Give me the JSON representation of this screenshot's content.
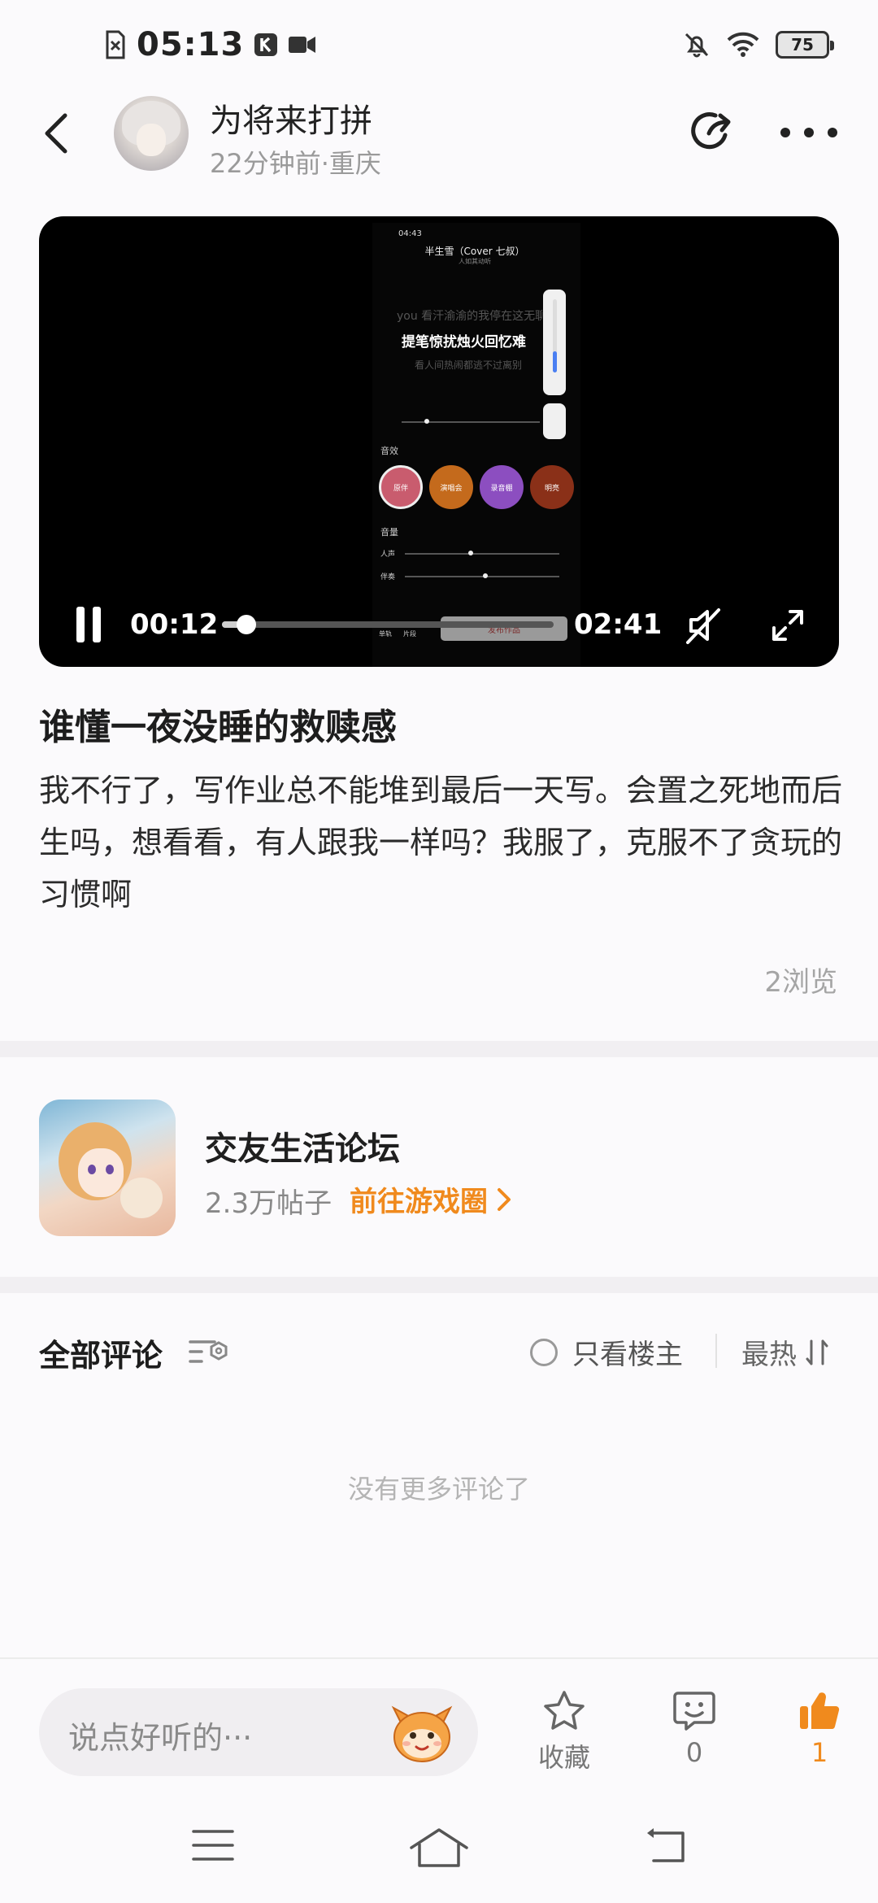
{
  "status_bar": {
    "time": "05:13",
    "battery": "75",
    "icons": [
      "sim-off-icon",
      "k-app-icon",
      "video-record-icon",
      "bell-off-icon",
      "wifi-icon",
      "battery-icon"
    ]
  },
  "header": {
    "user_name": "为将来打拼",
    "meta": "22分钟前·重庆",
    "icons": [
      "back-icon",
      "share-icon",
      "more-icon"
    ]
  },
  "video": {
    "current_time": "00:12",
    "duration": "02:41",
    "progress": 0.074,
    "embedded_screen": {
      "time": "04:43",
      "song_title": "半生雪（Cover 七叔）",
      "artist": "人如其动听",
      "lyric_prev": "you 看汗渝渝的我停在这无聊",
      "lyric_current": "提笔惊扰烛火回忆难",
      "lyric_next": "看人间热闹都逃不过离别",
      "section_effects": "音效",
      "effect_1": "原伴",
      "effect_2": "演唱会",
      "effect_3": "录音棚",
      "effect_4": "明亮",
      "section_volume": "音量",
      "vocal_label": "人声",
      "accomp_label": "伴奏",
      "publish_label": "发布作品",
      "bottom_1": "单轨",
      "bottom_2": "片段"
    }
  },
  "post": {
    "title": "谁懂一夜没睡的救赎感",
    "body": "我不行了，写作业总不能堆到最后一天写。会置之死地而后生吗，想看看，有人跟我一样吗？我服了，克服不了贪玩的习惯啊",
    "views": "2浏览"
  },
  "forum": {
    "name": "交友生活论坛",
    "posts": "2.3万帖子",
    "link": "前往游戏圈"
  },
  "comments": {
    "title": "全部评论",
    "only_owner": "只看楼主",
    "sort": "最热",
    "empty_text": "没有更多评论了"
  },
  "bottom_bar": {
    "input_placeholder": "说点好听的···",
    "favorite_label": "收藏",
    "comment_count": "0",
    "like_count": "1"
  },
  "colors": {
    "accent": "#f08a1d",
    "video_bg": "#000000",
    "muted_text": "#9a9a9a"
  }
}
